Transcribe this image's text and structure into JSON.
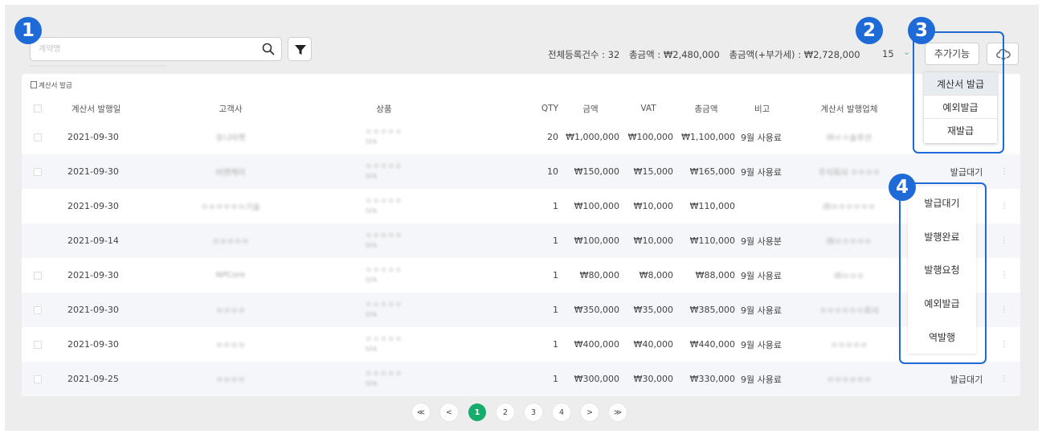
{
  "search": {
    "placeholder": "계약명",
    "value": ""
  },
  "summary": {
    "total_count": "전체등록건수 : 32",
    "total_amount": "총금액 : ₩2,480,000",
    "total_amount_vat": "총금액(+부가세) : ₩2,728,000"
  },
  "per_page": "15",
  "buttons": {
    "extra_features": "추가기능"
  },
  "table": {
    "caption": "계산서 발급",
    "headers": {
      "issue_date": "계산서 발행일",
      "customer": "고객사",
      "product": "상품",
      "qty": "QTY",
      "amount": "금액",
      "vat": "VAT",
      "total": "총금액",
      "note": "비고",
      "issuer": "계산서 발행업체"
    },
    "rows": [
      {
        "date": "2021-09-30",
        "customer": "유니마켓",
        "product": "ㅇㅇㅇㅇㅇ",
        "product_sub": "SFA",
        "qty": "20",
        "amount": "₩1,000,000",
        "vat": "₩100,000",
        "total": "₩1,100,000",
        "note": "9월 사용료",
        "issuer": "㈜ㅇㅇ솔루션",
        "status": ""
      },
      {
        "date": "2021-09-30",
        "customer": "비엔케이",
        "product": "ㅇㅇㅇㅇㅇ",
        "product_sub": "SFA",
        "qty": "10",
        "amount": "₩150,000",
        "vat": "₩15,000",
        "total": "₩165,000",
        "note": "9월 사용료",
        "issuer": "주식회사 ㅇㅇㅇㅇ",
        "status": "발급대기"
      },
      {
        "date": "2021-09-30",
        "customer": "ㅇㅇㅇㅇㅇㅇ기술",
        "product": "ㅇㅇㅇㅇㅇ",
        "product_sub": "SFA",
        "qty": "1",
        "amount": "₩100,000",
        "vat": "₩10,000",
        "total": "₩110,000",
        "note": "",
        "issuer": "㈜ㅇㅇㅇㅇㅇㅇ",
        "status": ""
      },
      {
        "date": "2021-09-14",
        "customer": "ㅇㅇㅇㅇㅇ",
        "product": "ㅇㅇㅇㅇㅇ",
        "product_sub": "SFA",
        "qty": "1",
        "amount": "₩100,000",
        "vat": "₩10,000",
        "total": "₩110,000",
        "note": "9월 사용분",
        "issuer": "㈜ㅇㅇㅇㅇㅇ",
        "status": ""
      },
      {
        "date": "2021-09-30",
        "customer": "NPCore",
        "product": "ㅇㅇㅇㅇㅇ",
        "product_sub": "SFA",
        "qty": "1",
        "amount": "₩80,000",
        "vat": "₩8,000",
        "total": "₩88,000",
        "note": "9월 사용료",
        "issuer": "㈜ㅇㅇㅇ",
        "status": ""
      },
      {
        "date": "2021-09-30",
        "customer": "ㅇㅇㅇㅇ",
        "product": "ㅇㅇㅇㅇㅇ",
        "product_sub": "SFA",
        "qty": "1",
        "amount": "₩350,000",
        "vat": "₩35,000",
        "total": "₩385,000",
        "note": "9월 사용료",
        "issuer": "ㅇㅇㅇㅇㅇㅇ회사",
        "status": ""
      },
      {
        "date": "2021-09-30",
        "customer": "ㅇㅇㅇㅇ",
        "product": "ㅇㅇㅇㅇㅇ",
        "product_sub": "SFA",
        "qty": "1",
        "amount": "₩400,000",
        "vat": "₩40,000",
        "total": "₩440,000",
        "note": "9월 사용료",
        "issuer": "ㅇㅇㅇㅇㅇ",
        "status": ""
      },
      {
        "date": "2021-09-25",
        "customer": "ㅇㅇㅇㅇ",
        "product": "ㅇㅇㅇㅇㅇ",
        "product_sub": "SFA",
        "qty": "1",
        "amount": "₩300,000",
        "vat": "₩30,000",
        "total": "₩330,000",
        "note": "9월 사용료",
        "issuer": "ㅇㅇㅇㅇㅇㅇ",
        "status": "발급대기"
      }
    ]
  },
  "extra_menu": [
    "계산서 발급",
    "예외발급",
    "재발급"
  ],
  "status_menu": [
    "발급대기",
    "발행완료",
    "발행요청",
    "예외발급",
    "역발행"
  ],
  "pagination": [
    "≪",
    "<",
    "1",
    "2",
    "3",
    "4",
    ">",
    "≫"
  ],
  "annotations": [
    "1",
    "2",
    "3",
    "4"
  ],
  "colors": {
    "accent_blue": "#1e6ad6",
    "active_page": "#15ad6b",
    "chevron": "#59c0a8"
  }
}
